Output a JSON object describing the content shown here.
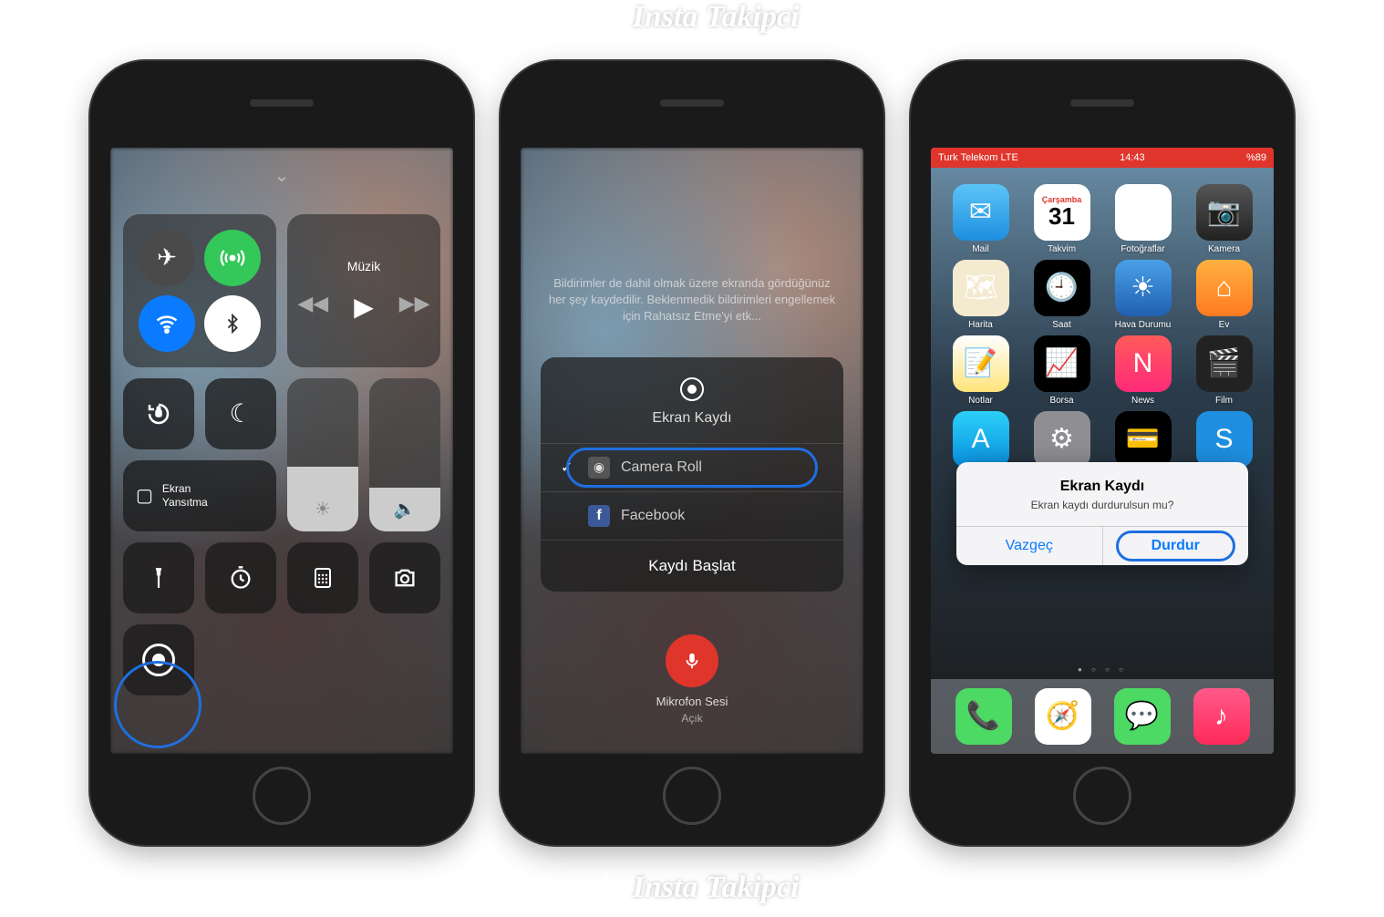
{
  "watermark": "Insta Takipci",
  "phone1": {
    "music_label": "Müzik",
    "mirror_label": "Ekran\nYansıtma"
  },
  "phone2": {
    "hint": "Bildirimler de dahil olmak üzere ekranda gördüğünüz her şey kaydedilir. Beklenmedik bildirimleri engellemek için Rahatsız Etme'yi etk...",
    "title": "Ekran Kaydı",
    "option_camera": "Camera Roll",
    "option_facebook": "Facebook",
    "start": "Kaydı Başlat",
    "mic_label": "Mikrofon Sesi",
    "mic_state": "Açık"
  },
  "phone3": {
    "status": {
      "carrier": "Turk Telekom  LTE",
      "time": "14:43",
      "battery": "%89"
    },
    "apps": {
      "mail": "Mail",
      "cal": "Takvim",
      "cal_day": "Çarşamba",
      "cal_num": "31",
      "photos": "Fotoğraflar",
      "camera": "Kamera",
      "maps": "Harita",
      "clock": "Saat",
      "weather": "Hava Durumu",
      "home": "Ev",
      "notes": "Notlar",
      "stocks": "Borsa",
      "news": "News",
      "movies": "Film",
      "appstore": "App",
      "settings": "Ayarlar",
      "wallet": "Wallet",
      "shazam": "Shazam"
    },
    "alert": {
      "title": "Ekran Kaydı",
      "message": "Ekran kaydı durdurulsun mu?",
      "cancel": "Vazgeç",
      "stop": "Durdur"
    }
  }
}
